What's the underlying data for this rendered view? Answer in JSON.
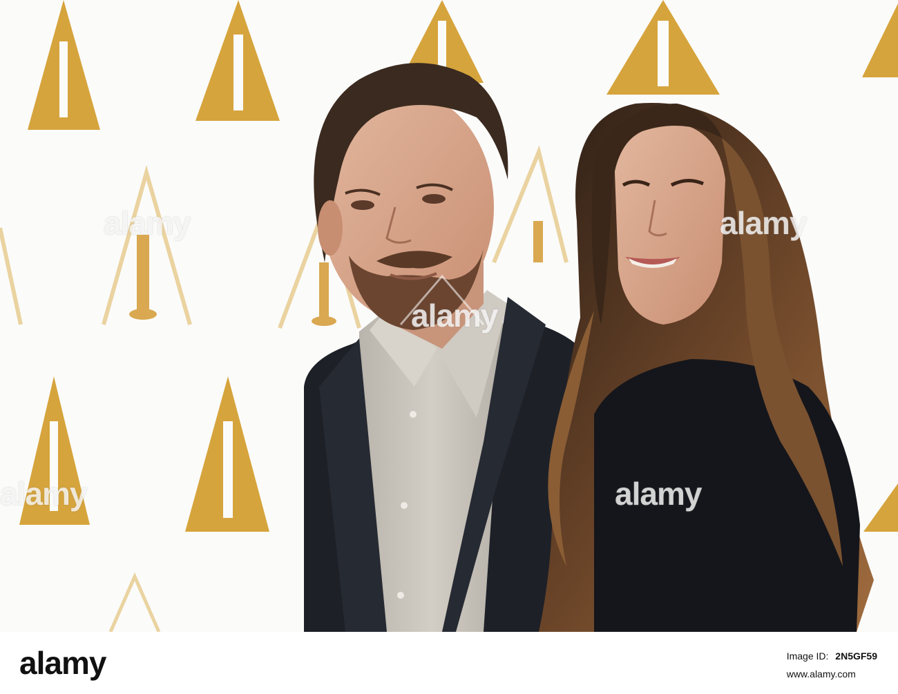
{
  "watermark": {
    "text": "alamy"
  },
  "footer": {
    "brand": "alamy",
    "image_id_label": "Image ID:",
    "image_id": "2N5GF59",
    "site": "www.alamy.com"
  },
  "colors": {
    "backdrop": "#fbfbfa",
    "oscar_gold": "#d6a43c",
    "oscar_gold_faded": "#ead3a0",
    "jacket": "#1d2027",
    "shirt": "#c7c2ba",
    "hair_dark": "#3b2a1f",
    "hair_light": "#9b6a3d",
    "skin": "#d7a58a"
  }
}
